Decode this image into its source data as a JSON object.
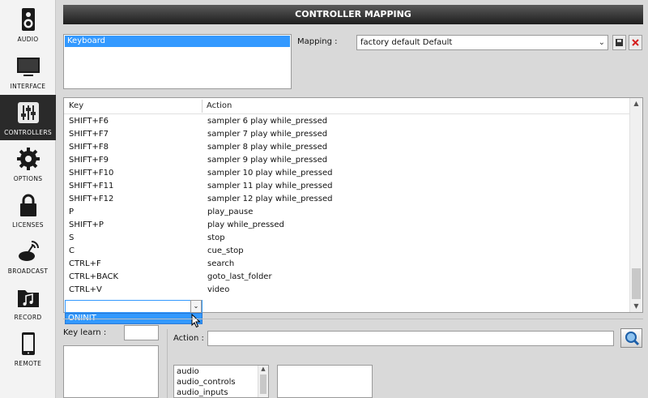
{
  "colors": {
    "sidebar_active_bg": "#2a2a2a",
    "selection_blue": "#3399ff",
    "header_dark": "#1e1e1e",
    "delete_red": "#d42020"
  },
  "sidebar": {
    "items": [
      {
        "label": "AUDIO",
        "icon": "speaker-icon",
        "active": false
      },
      {
        "label": "INTERFACE",
        "icon": "monitor-icon",
        "active": false
      },
      {
        "label": "CONTROLLERS",
        "icon": "sliders-icon",
        "active": true
      },
      {
        "label": "OPTIONS",
        "icon": "gear-icon",
        "active": false
      },
      {
        "label": "LICENSES",
        "icon": "lock-icon",
        "active": false
      },
      {
        "label": "BROADCAST",
        "icon": "satellite-dish-icon",
        "active": false
      },
      {
        "label": "RECORD",
        "icon": "music-folder-icon",
        "active": false
      },
      {
        "label": "REMOTE",
        "icon": "tablet-icon",
        "active": false
      }
    ]
  },
  "header": {
    "title": "CONTROLLER MAPPING"
  },
  "devices": {
    "selected": "Keyboard"
  },
  "mapping": {
    "label": "Mapping :",
    "value": "factory default Default",
    "save_icon": "floppy-disk-icon",
    "delete_icon": "close-x-icon"
  },
  "table": {
    "columns": [
      "Key",
      "Action"
    ],
    "rows": [
      {
        "key": "SHIFT+F6",
        "action": "sampler 6 play while_pressed"
      },
      {
        "key": "SHIFT+F7",
        "action": "sampler 7 play while_pressed"
      },
      {
        "key": "SHIFT+F8",
        "action": "sampler 8 play while_pressed"
      },
      {
        "key": "SHIFT+F9",
        "action": "sampler 9 play while_pressed"
      },
      {
        "key": "SHIFT+F10",
        "action": "sampler 10 play while_pressed"
      },
      {
        "key": "SHIFT+F11",
        "action": "sampler 11 play while_pressed"
      },
      {
        "key": "SHIFT+F12",
        "action": "sampler 12 play while_pressed"
      },
      {
        "key": "P",
        "action": "play_pause"
      },
      {
        "key": "SHIFT+P",
        "action": "play while_pressed"
      },
      {
        "key": "S",
        "action": "stop"
      },
      {
        "key": "C",
        "action": "cue_stop"
      },
      {
        "key": "CTRL+F",
        "action": "search"
      },
      {
        "key": "CTRL+BACK",
        "action": "goto_last_folder"
      },
      {
        "key": "CTRL+V",
        "action": "video"
      }
    ]
  },
  "edit_row": {
    "dropdown_option": "ONINIT"
  },
  "bottom": {
    "key_learn_label": "Key learn :",
    "action_label": "Action :",
    "categories": [
      "audio",
      "audio_controls",
      "audio_inputs"
    ]
  }
}
